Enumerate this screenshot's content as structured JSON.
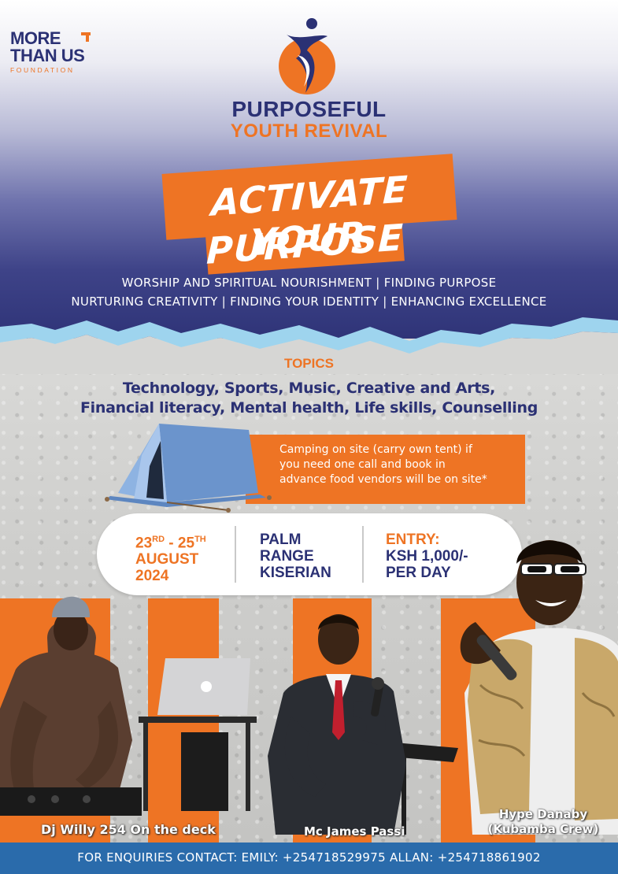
{
  "org_logo": {
    "line1": "MORE",
    "line2": "THAN US",
    "line3": "FOUNDATION",
    "mark_symbol": "plus-arrow-icon"
  },
  "event_logo": {
    "title_line1": "PURPOSEFUL",
    "title_line2": "YOUTH REVIVAL",
    "mark_symbol": "figure-mark-icon"
  },
  "headline": {
    "line1": "ACTIVATE YOUR",
    "line2": "PURPOSE"
  },
  "focus_lines": [
    "WORSHIP AND SPIRITUAL NOURISHMENT | FINDING PURPOSE",
    "NURTURING CREATIVITY |  FINDING YOUR IDENTITY | ENHANCING EXCELLENCE"
  ],
  "topics": {
    "heading": "TOPICS",
    "line1": "Technology, Sports, Music, Creative and Arts,",
    "line2": "Financial literacy, Mental health, Life skills, Counselling"
  },
  "camping": {
    "icon": "tent-icon",
    "line1": "Camping on site (carry own tent) if",
    "line2": "you need one call and book in",
    "line3": "advance food vendors will be on site*"
  },
  "details": {
    "date_line1": "23RD - 25TH",
    "date_line2": "AUGUST",
    "date_line3": "2024",
    "venue_line1": "PALM",
    "venue_line2": "RANGE",
    "venue_line3": "KISERIAN",
    "entry_line1": "ENTRY:",
    "entry_line2": "KSH 1,000/-",
    "entry_line3": "PER DAY"
  },
  "performers": [
    {
      "caption": "Dj Willy 254 On the deck"
    },
    {
      "caption": "Mc James Passi"
    },
    {
      "caption_line1": "Hype Danaby",
      "caption_line2": "(Kubamba Crew)"
    }
  ],
  "footer": {
    "text": "FOR ENQUIRIES CONTACT: EMILY: +254718529975 ALLAN: +254718861902"
  },
  "colors": {
    "navy": "#2b3174",
    "orange": "#ee7424",
    "footer_blue": "#2a6bab",
    "light_blue": "#9ed4ee"
  }
}
